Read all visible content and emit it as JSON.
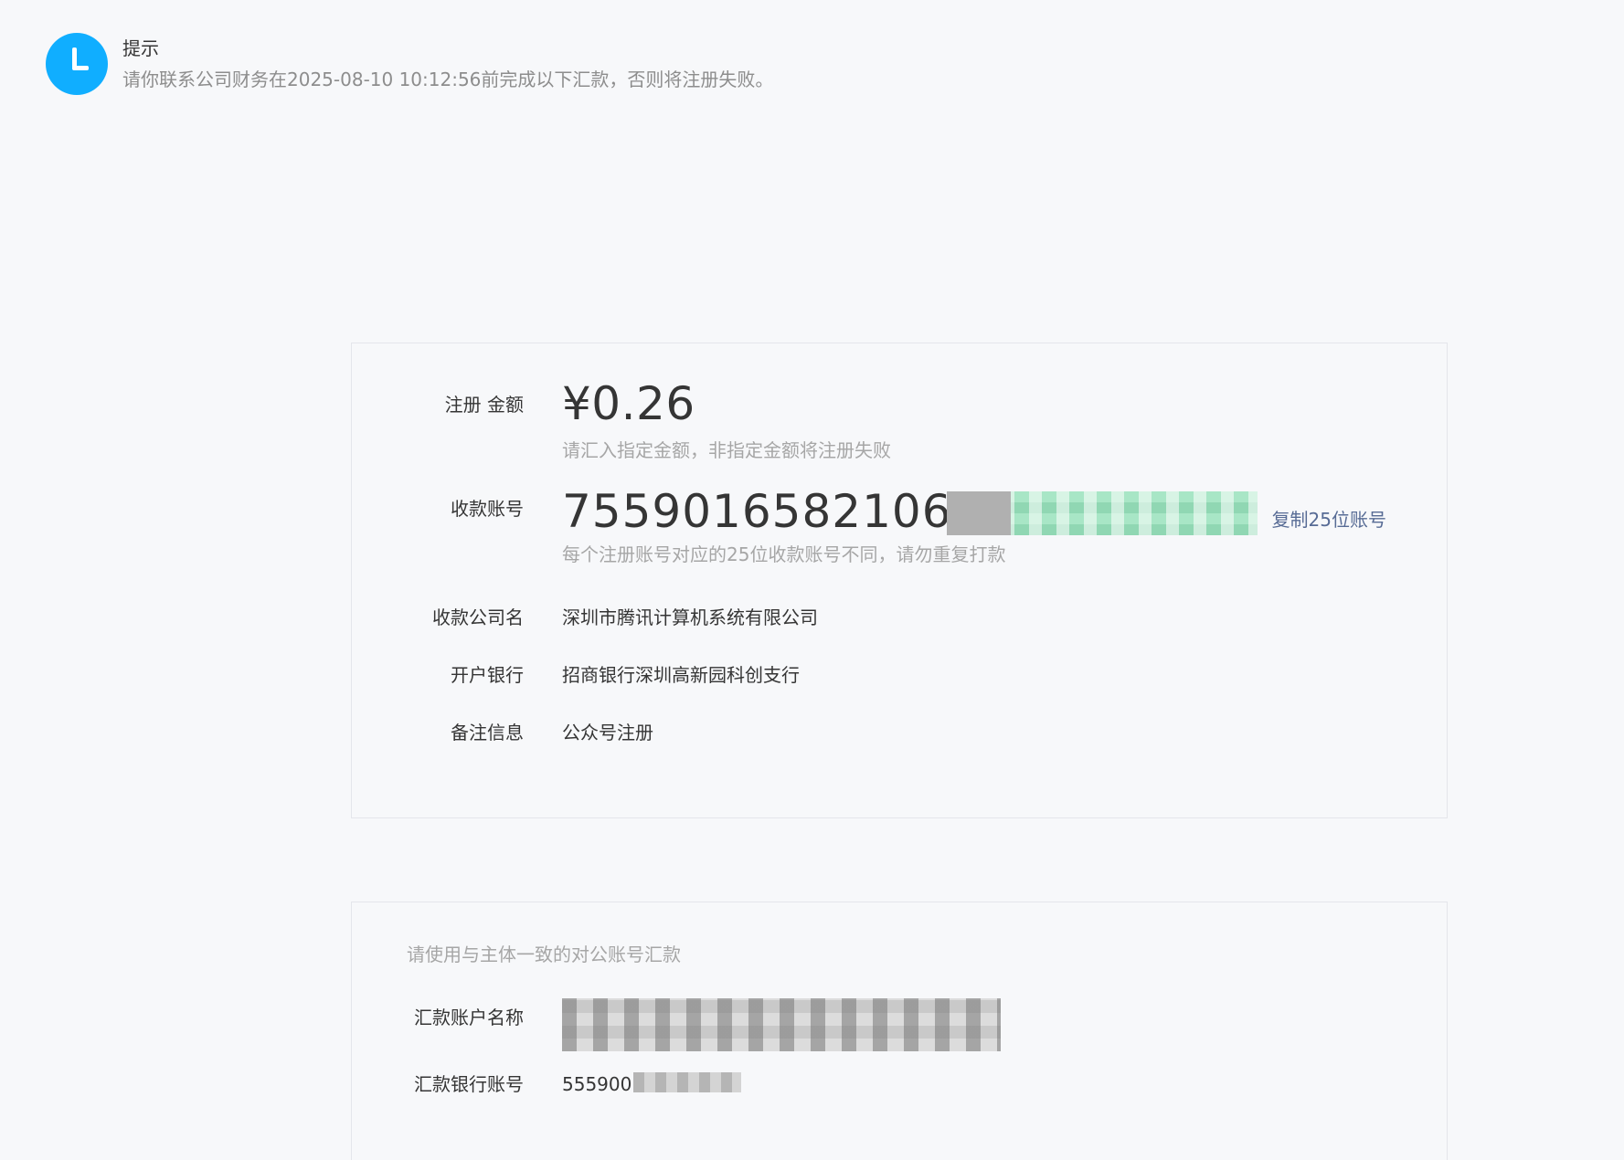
{
  "notice": {
    "icon": "clock-icon",
    "title": "提示",
    "description": "请你联系公司财务在2025-08-10 10:12:56前完成以下汇款，否则将注册失败。",
    "accent_color": "#10aeff"
  },
  "payment": {
    "amount_label": "注册 金额",
    "amount_value": "¥0.26",
    "amount_hint": "请汇入指定金额，非指定金额将注册失败",
    "account_label": "收款账号",
    "account_value_visible": "7559016582106",
    "copy_label": "复制25位账号",
    "account_hint": "每个注册账号对应的25位收款账号不同，请勿重复打款",
    "company_label": "收款公司名",
    "company_value": "深圳市腾讯计算机系统有限公司",
    "bank_label": "开户银行",
    "bank_value": "招商银行深圳高新园科创支行",
    "remark_label": "备注信息",
    "remark_value": "公众号注册",
    "link_color": "#576b95"
  },
  "remitter": {
    "tip": "请使用与主体一致的对公账号汇款",
    "name_label": "汇款账户名称",
    "bank_account_label": "汇款银行账号",
    "bank_account_visible": "555900"
  }
}
